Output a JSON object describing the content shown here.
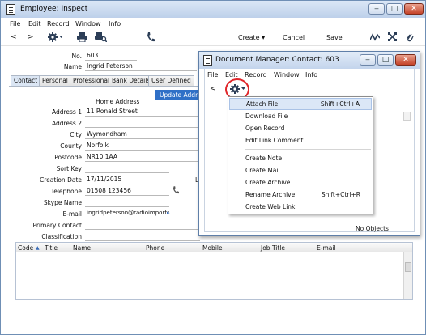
{
  "main_window": {
    "title": "Employee: Inspect",
    "menu": [
      "File",
      "Edit",
      "Record",
      "Window",
      "Info"
    ],
    "toolbar": {
      "back": "<",
      "forward": ">",
      "create_label": "Create",
      "cancel_label": "Cancel",
      "save_label": "Save"
    },
    "header_fields": {
      "no_label": "No.",
      "no_value": "603",
      "name_label": "Name",
      "name_value": "Ingrid Peterson"
    },
    "tabs": [
      "Contact",
      "Personal",
      "Professional",
      "Bank Details",
      "User Defined"
    ],
    "active_tab": "Contact",
    "home_address_label": "Home Address",
    "update_address_button": "Update Address",
    "form": [
      {
        "label": "Address 1",
        "value": "11 Ronald Street"
      },
      {
        "label": "Address 2",
        "value": ""
      },
      {
        "label": "City",
        "value": "Wymondham"
      },
      {
        "label": "County",
        "value": "Norfolk"
      },
      {
        "label": "Postcode",
        "value": "NR10 1AA"
      },
      {
        "label": "Sort Key",
        "value": ""
      },
      {
        "label": "Creation Date",
        "value": "17/11/2015"
      },
      {
        "label": "Telephone",
        "value": "01508 123456"
      },
      {
        "label": "Skype Name",
        "value": ""
      },
      {
        "label": "E-mail",
        "value": "ingridpeterson@radioimporte"
      },
      {
        "label": "Primary Contact",
        "value": ""
      },
      {
        "label": "Classification",
        "value": ""
      }
    ],
    "extra_label_fragment": "L",
    "grid_columns": [
      "Code",
      "Title",
      "Name",
      "Phone",
      "Mobile",
      "Job Title",
      "E-mail"
    ]
  },
  "doc_manager": {
    "title": "Document Manager: Contact: 603",
    "menu": [
      "File",
      "Edit",
      "Record",
      "Window",
      "Info"
    ],
    "back": "<",
    "status": "No Objects",
    "menu_items": [
      {
        "label": "Attach File",
        "shortcut": "Shift+Ctrl+A",
        "highlighted": true
      },
      {
        "label": "Download File",
        "shortcut": ""
      },
      {
        "label": "Open Record",
        "shortcut": ""
      },
      {
        "label": "Edit Link Comment",
        "shortcut": ""
      },
      {
        "label": "Create Note",
        "shortcut": ""
      },
      {
        "label": "Create Mail",
        "shortcut": ""
      },
      {
        "label": "Create Archive",
        "shortcut": ""
      },
      {
        "label": "Rename Archive",
        "shortcut": "Shift+Ctrl+R"
      },
      {
        "label": "Create Web Link",
        "shortcut": ""
      }
    ]
  },
  "colors": {
    "highlight_ring": "#e0262a",
    "update_button": "#2f70c7",
    "menu_highlight": "#dbe7f7"
  }
}
